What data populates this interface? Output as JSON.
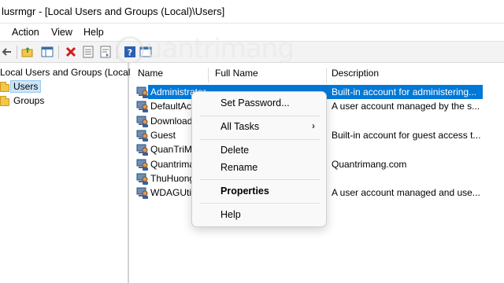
{
  "window": {
    "title": "lusrmgr - [Local Users and Groups (Local)\\Users]"
  },
  "menu": {
    "action": "Action",
    "view": "View",
    "help": "Help"
  },
  "toolbar": {
    "buttons": [
      "back-icon",
      "forward-icon",
      "up-folder-icon",
      "show-hide-tree-icon",
      "delete-icon",
      "properties-icon",
      "export-list-icon",
      "help-icon",
      "console-icon"
    ]
  },
  "tree": {
    "root": "Local Users and Groups (Local)",
    "items": [
      {
        "label": "Users",
        "selected": true
      },
      {
        "label": "Groups",
        "selected": false
      }
    ]
  },
  "list": {
    "columns": {
      "name": "Name",
      "full_name": "Full Name",
      "description": "Description"
    },
    "rows": [
      {
        "name": "Administrator",
        "full_name": "",
        "description": "Built-in account for administering...",
        "selected": true
      },
      {
        "name": "DefaultAc",
        "full_name": "",
        "description": "A user account managed by the s..."
      },
      {
        "name": "Download",
        "full_name": "",
        "description": ""
      },
      {
        "name": "Guest",
        "full_name": "",
        "description": "Built-in account for guest access t..."
      },
      {
        "name": "QuanTriM",
        "full_name": "",
        "description": ""
      },
      {
        "name": "Quantrima",
        "full_name": "",
        "description": "Quantrimang.com"
      },
      {
        "name": "ThuHuong",
        "full_name": "",
        "description": ""
      },
      {
        "name": "WDAGUtil",
        "full_name": "",
        "description": "A user account managed and use..."
      }
    ]
  },
  "context_menu": {
    "set_password": "Set Password...",
    "all_tasks": "All Tasks",
    "delete": "Delete",
    "rename": "Rename",
    "properties": "Properties",
    "help": "Help"
  },
  "watermark": {
    "text": "uantrimang"
  },
  "colors": {
    "selection": "#0078d7",
    "tree_selection": "#cce4f7"
  }
}
